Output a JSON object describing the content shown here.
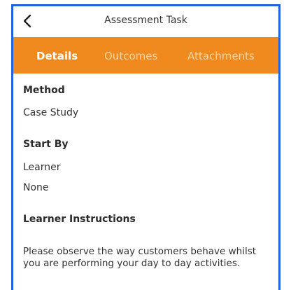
{
  "header": {
    "title": "Assessment Task",
    "back_icon": "chevron-left-icon"
  },
  "tabs": [
    {
      "label": "Details",
      "active": true
    },
    {
      "label": "Outcomes",
      "active": false
    },
    {
      "label": "Attachments",
      "active": false
    }
  ],
  "details": {
    "method_label": "Method",
    "method_value": "Case Study",
    "start_by_label": "Start By",
    "start_by_value": "Learner",
    "start_by_date": "None",
    "instructions_label": "Learner Instructions",
    "instructions_text": "Please observe the way customers behave whilst you are performing your day to day activities."
  },
  "colors": {
    "accent": "#f08a1f",
    "frame_border": "#1f63e0"
  }
}
